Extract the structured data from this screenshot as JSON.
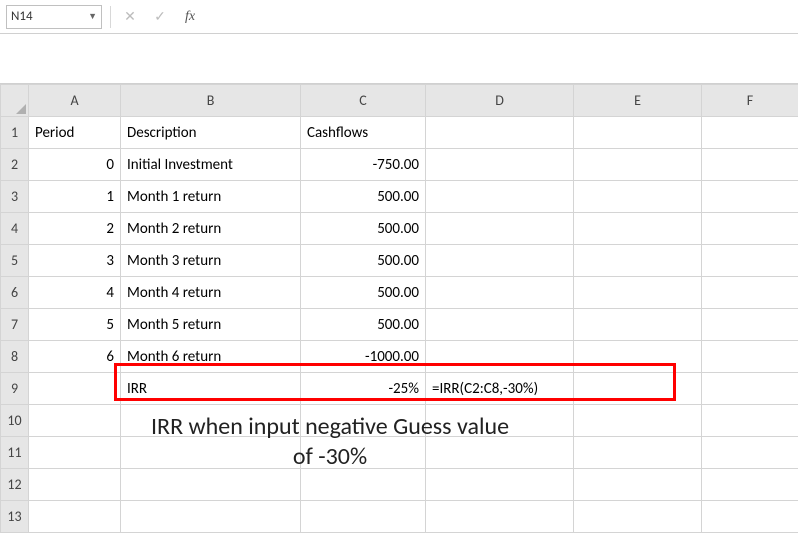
{
  "formula_bar": {
    "name_box": "N14",
    "formula": ""
  },
  "columns": [
    "A",
    "B",
    "C",
    "D",
    "E",
    "F"
  ],
  "row_headers": [
    "1",
    "2",
    "3",
    "4",
    "5",
    "6",
    "7",
    "8",
    "9",
    "10",
    "11",
    "12",
    "13"
  ],
  "headers": {
    "A": "Period",
    "B": "Description",
    "C": "Cashflows"
  },
  "rows": [
    {
      "A": "0",
      "B": "Initial Investment",
      "C": "-750.00"
    },
    {
      "A": "1",
      "B": "Month 1 return",
      "C": "500.00"
    },
    {
      "A": "2",
      "B": "Month 2 return",
      "C": "500.00"
    },
    {
      "A": "3",
      "B": "Month 3 return",
      "C": "500.00"
    },
    {
      "A": "4",
      "B": "Month 4 return",
      "C": "500.00"
    },
    {
      "A": "5",
      "B": "Month 5 return",
      "C": "500.00"
    },
    {
      "A": "6",
      "B": "Month 6 return",
      "C": "-1000.00"
    }
  ],
  "irr": {
    "B": "IRR",
    "C": "-25%",
    "D": "=IRR(C2:C8,-30%)"
  },
  "caption": "IRR when input negative Guess value of -30%",
  "chart_data": {
    "type": "table",
    "headers": [
      "Period",
      "Description",
      "Cashflows"
    ],
    "rows": [
      [
        0,
        "Initial Investment",
        -750.0
      ],
      [
        1,
        "Month 1 return",
        500.0
      ],
      [
        2,
        "Month 2 return",
        500.0
      ],
      [
        3,
        "Month 3 return",
        500.0
      ],
      [
        4,
        "Month 4 return",
        500.0
      ],
      [
        5,
        "Month 5 return",
        500.0
      ],
      [
        6,
        "Month 6 return",
        -1000.0
      ]
    ],
    "summary": {
      "label": "IRR",
      "value": "-25%",
      "formula": "=IRR(C2:C8,-30%)"
    }
  }
}
